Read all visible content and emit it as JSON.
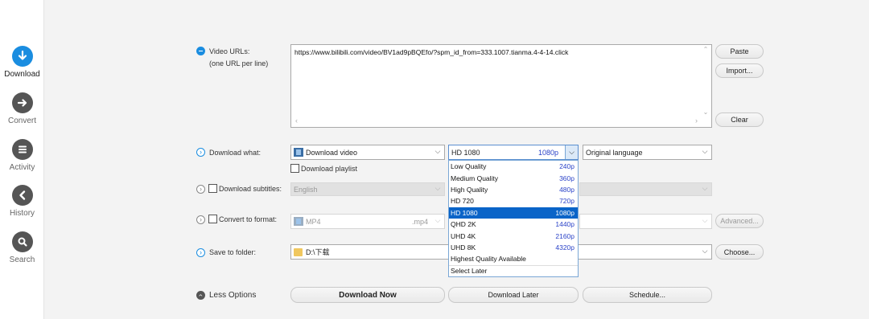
{
  "sidebar": {
    "items": [
      {
        "label": "Download",
        "icon": "download-icon",
        "active": true
      },
      {
        "label": "Convert",
        "icon": "convert-icon",
        "active": false
      },
      {
        "label": "Activity",
        "icon": "activity-icon",
        "active": false
      },
      {
        "label": "History",
        "icon": "history-icon",
        "active": false
      },
      {
        "label": "Search",
        "icon": "search-icon",
        "active": false
      }
    ]
  },
  "urls": {
    "label": "Video URLs:",
    "sublabel": "(one URL per line)",
    "value": "https://www.bilibili.com/video/BV1ad9pBQEfo/?spm_id_from=333.1007.tianma.4-4-14.click",
    "paste_label": "Paste",
    "import_label": "Import...",
    "clear_label": "Clear"
  },
  "download_what": {
    "label": "Download what:",
    "value": "Download video",
    "playlist_label": "Download playlist"
  },
  "quality": {
    "value": "HD 1080",
    "res": "1080p",
    "options": [
      {
        "name": "Low Quality",
        "res": "240p"
      },
      {
        "name": "Medium Quality",
        "res": "360p"
      },
      {
        "name": "High Quality",
        "res": "480p"
      },
      {
        "name": "HD 720",
        "res": "720p"
      },
      {
        "name": "HD 1080",
        "res": "1080p",
        "selected": true
      },
      {
        "name": "QHD 2K",
        "res": "1440p"
      },
      {
        "name": "UHD 4K",
        "res": "2160p"
      },
      {
        "name": "UHD 8K",
        "res": "4320p"
      },
      {
        "name": "Highest Quality Available",
        "res": ""
      },
      {
        "name": "Select Later",
        "res": ""
      }
    ]
  },
  "language": {
    "value": "Original language"
  },
  "subtitles": {
    "label": "Download subtitles:",
    "value": "English"
  },
  "convert": {
    "label": "Convert to format:",
    "value": "MP4",
    "ext": ".mp4",
    "advanced_label": "Advanced..."
  },
  "folder": {
    "label": "Save to folder:",
    "value": "D:\\下载",
    "choose_label": "Choose..."
  },
  "actions": {
    "less_options": "Less Options",
    "download_now": "Download Now",
    "download_later": "Download Later",
    "schedule": "Schedule..."
  },
  "colors": {
    "accent": "#1a8de0",
    "selection": "#0a64c8",
    "resolution_text": "#2b43c8"
  }
}
